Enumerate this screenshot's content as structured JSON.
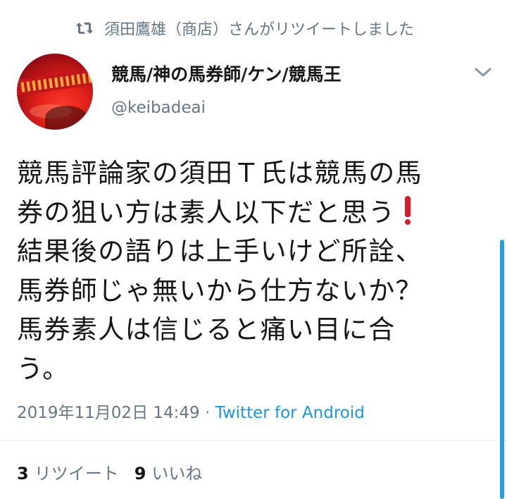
{
  "retweet": {
    "icon": "retweet-icon",
    "text": "須田鷹雄（商店）さんがリツイートしました"
  },
  "author": {
    "name": "競馬/神の馬券師/ケン/競馬王",
    "handle": "@keibadeai",
    "avatar_icon": "avatar-image"
  },
  "tweet": {
    "lines": [
      "競馬評論家の須田Ｔ氏は競馬の馬",
      "券の狙い方は素人以下だと思う",
      "結果後の語りは上手いけど所詮、",
      "馬券師じゃ無いから仕方ないか？",
      "馬券素人は信じると痛い目に合",
      "う。"
    ],
    "emoji": "red-exclamation-icon",
    "timestamp": "2019年11月02日 14:49",
    "separator": " · ",
    "source": "Twitter for Android"
  },
  "stats": {
    "retweet_count": "3",
    "retweet_label": "リツイート",
    "like_count": "9",
    "like_label": "いいね"
  },
  "colors": {
    "text": "#14171a",
    "secondary": "#657786",
    "link": "#1b95e0",
    "accent_red": "#d91b2a"
  }
}
